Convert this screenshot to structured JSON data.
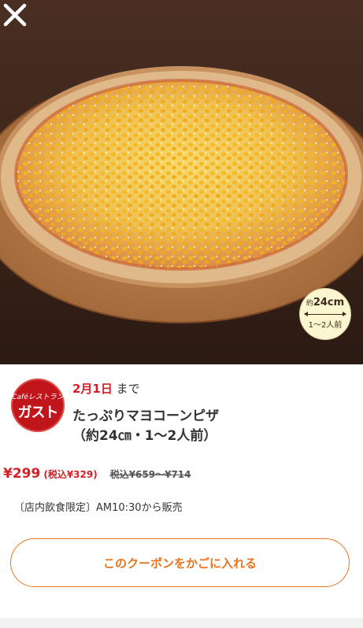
{
  "header": {
    "close_icon": "close-icon"
  },
  "photo": {
    "alt": "pizza-photo",
    "size_badge": {
      "prefix": "約",
      "size": "24cm",
      "servings": "1〜2人前"
    }
  },
  "coupon": {
    "brand_logo": {
      "line1": "Caféレストラン",
      "line2": "ガスト"
    },
    "deadline_date": "2月1日",
    "deadline_suffix": " まで",
    "title_line1": "たっぷりマヨコーンピザ",
    "title_line2": "（約24㎝・1〜2人前）",
    "price": "¥299",
    "price_tax_included": "(税込¥329)",
    "regular_price": "税込¥659〜¥714",
    "note": "〔店内飲食限定〕AM10:30から販売",
    "add_to_cart_label": "このクーポンをかごに入れる"
  },
  "colors": {
    "accent_red": "#d32027",
    "button_orange": "#e8741e",
    "brand_red": "#c0161b"
  }
}
